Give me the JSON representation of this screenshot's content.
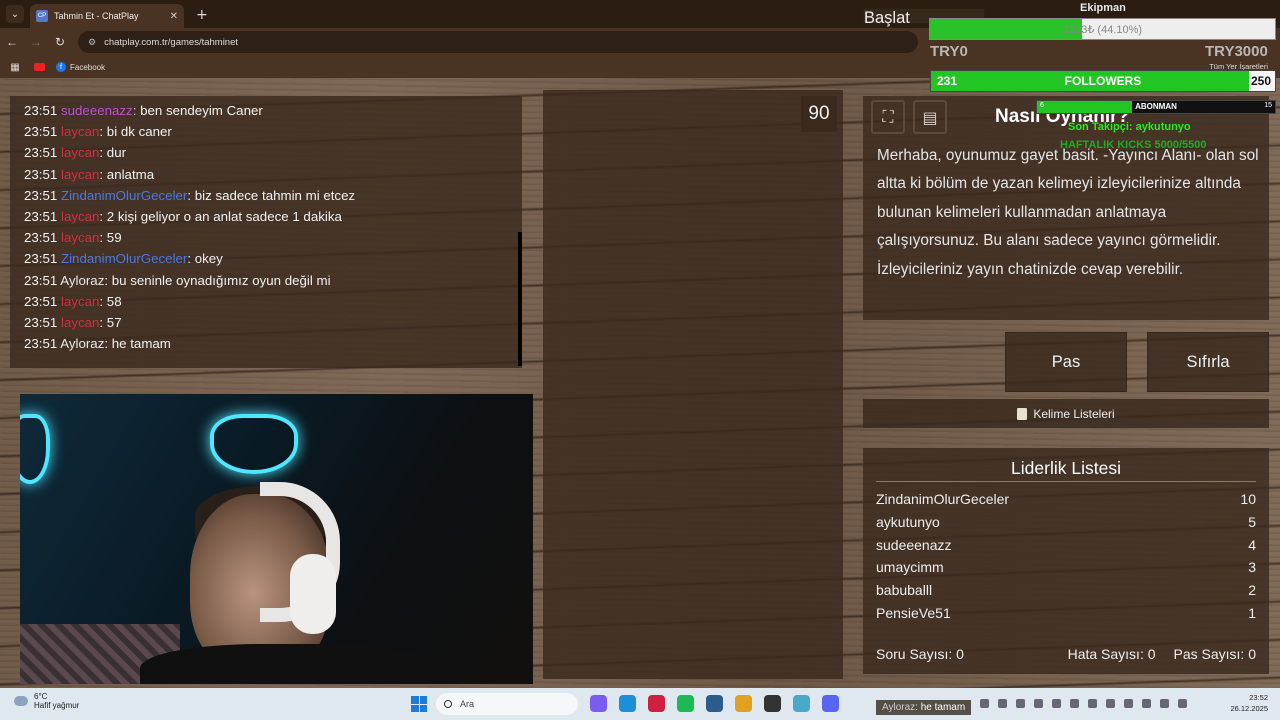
{
  "browser": {
    "tab_title": "Tahmin Et - ChatPlay",
    "tab_favicon": "CP",
    "url": "chatplay.com.tr/games/tahminet",
    "bookmark_facebook": "Facebook",
    "bookmarks_right": "Tüm Yer İşaretleri"
  },
  "chat": {
    "messages": [
      {
        "time": "23:51",
        "user": "sudeeenazz",
        "text": ": ben sendeyim Caner"
      },
      {
        "time": "23:51",
        "user": "laycan",
        "text": ": bi dk caner"
      },
      {
        "time": "23:51",
        "user": "laycan",
        "text": ": dur"
      },
      {
        "time": "23:51",
        "user": "laycan",
        "text": ": anlatma"
      },
      {
        "time": "23:51",
        "user": "ZindanimOlurGeceler",
        "text": ": biz sadece tahmin mi etcez"
      },
      {
        "time": "23:51",
        "user": "laycan",
        "text": ": 2 kişi geliyor o an anlat sadece 1 dakika"
      },
      {
        "time": "23:51",
        "user": "laycan",
        "text": ": 59"
      },
      {
        "time": "23:51",
        "user": "ZindanimOlurGeceler",
        "text": ": okey"
      },
      {
        "time": "23:51",
        "user": "Ayloraz",
        "text": ": bu seninle oynadığımız oyun değil mi"
      },
      {
        "time": "23:51",
        "user": "laycan",
        "text": ": 58"
      },
      {
        "time": "23:51",
        "user": "laycan",
        "text": ": 57"
      },
      {
        "time": "23:51",
        "user": "Ayloraz",
        "text": ": he tamam"
      }
    ]
  },
  "game": {
    "timer": "90",
    "howto_title": "Nasıl Oynanır?",
    "howto_text": "Merhaba, oyunumuz gayet basit. -Yayıncı Alanı- olan sol altta ki bölüm de yazan kelimeyi izleyicilerinize altında bulunan kelimeleri kullanmadan anlatmaya çalışıyorsunuz. Bu alanı sadece yayıncı görmelidir. İzleyicileriniz yayın chatinizde cevap verebilir.",
    "btn_start": "Başlat",
    "btn_pass": "Pas",
    "btn_reset": "Sıfırla",
    "word_lists": "Kelime Listeleri",
    "leaderboard_title": "Liderlik Listesi",
    "leaderboard": [
      {
        "name": "ZindanimOlurGeceler",
        "score": "10"
      },
      {
        "name": "aykutunyo",
        "score": "5"
      },
      {
        "name": "sudeeenazz",
        "score": "4"
      },
      {
        "name": "umaycimm",
        "score": "3"
      },
      {
        "name": "babuballl",
        "score": "2"
      },
      {
        "name": "PensieVe51",
        "score": "1"
      }
    ],
    "stats": {
      "questions": "Soru Sayısı: 0",
      "errors": "Hata Sayısı: 0",
      "passes": "Pas Sayısı: 0"
    }
  },
  "overlay": {
    "ekipman_title": "Ekipman",
    "ekipman_text": "1323₺ (44.10%)",
    "ekipman_fraction": 0.441,
    "try_min": "TRY0",
    "try_max": "TRY3000",
    "followers_current": "231",
    "followers_label": "FOLLOWERS",
    "followers_goal": "250",
    "followers_fraction": 0.924,
    "abonman_current": "6",
    "abonman_label": "ABONMAN",
    "abonman_goal": "15",
    "abonman_fraction": 0.4,
    "last_follower": "Son Takipçi: aykutunyo",
    "weekly_kicks": "HAFTALIK KICKS 5000/5500"
  },
  "taskbar": {
    "temperature": "6°C",
    "weather": "Hafif yağmur",
    "search_placeholder": "Ara",
    "stream_chat_user": "Ayloraz",
    "stream_chat_text": ": he tamam",
    "time": "23:52",
    "date": "26.12.2025"
  },
  "colors": {
    "accent_green": "#22c622",
    "user_purple": "#c050d0",
    "user_red": "#d03040",
    "user_blue": "#4a78e0"
  }
}
